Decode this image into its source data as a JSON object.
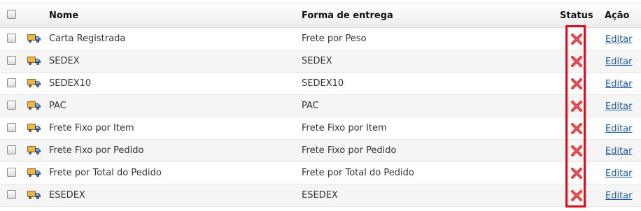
{
  "columns": {
    "name": "Nome",
    "delivery": "Forma de entrega",
    "status": "Status",
    "action": "Ação"
  },
  "rows": [
    {
      "name": "Carta Registrada",
      "delivery": "Frete por Peso",
      "action": "Editar"
    },
    {
      "name": "SEDEX",
      "delivery": "SEDEX",
      "action": "Editar"
    },
    {
      "name": "SEDEX10",
      "delivery": "SEDEX10",
      "action": "Editar"
    },
    {
      "name": "PAC",
      "delivery": "PAC",
      "action": "Editar"
    },
    {
      "name": "Frete Fixo por Item",
      "delivery": "Frete Fixo por Item",
      "action": "Editar"
    },
    {
      "name": "Frete Fixo por Pedido",
      "delivery": "Frete Fixo por Pedido",
      "action": "Editar"
    },
    {
      "name": "Frete por Total do Pedido",
      "delivery": "Frete por Total do Pedido",
      "action": "Editar"
    },
    {
      "name": "ESEDEX",
      "delivery": "ESEDEX",
      "action": "Editar"
    }
  ],
  "colors": {
    "link": "#1a5aa6",
    "status_inactive": "#e0353a",
    "highlight": "#d6121c"
  },
  "icons": {
    "row_icon": "truck-icon",
    "status_icon": "inactive-x-icon"
  }
}
